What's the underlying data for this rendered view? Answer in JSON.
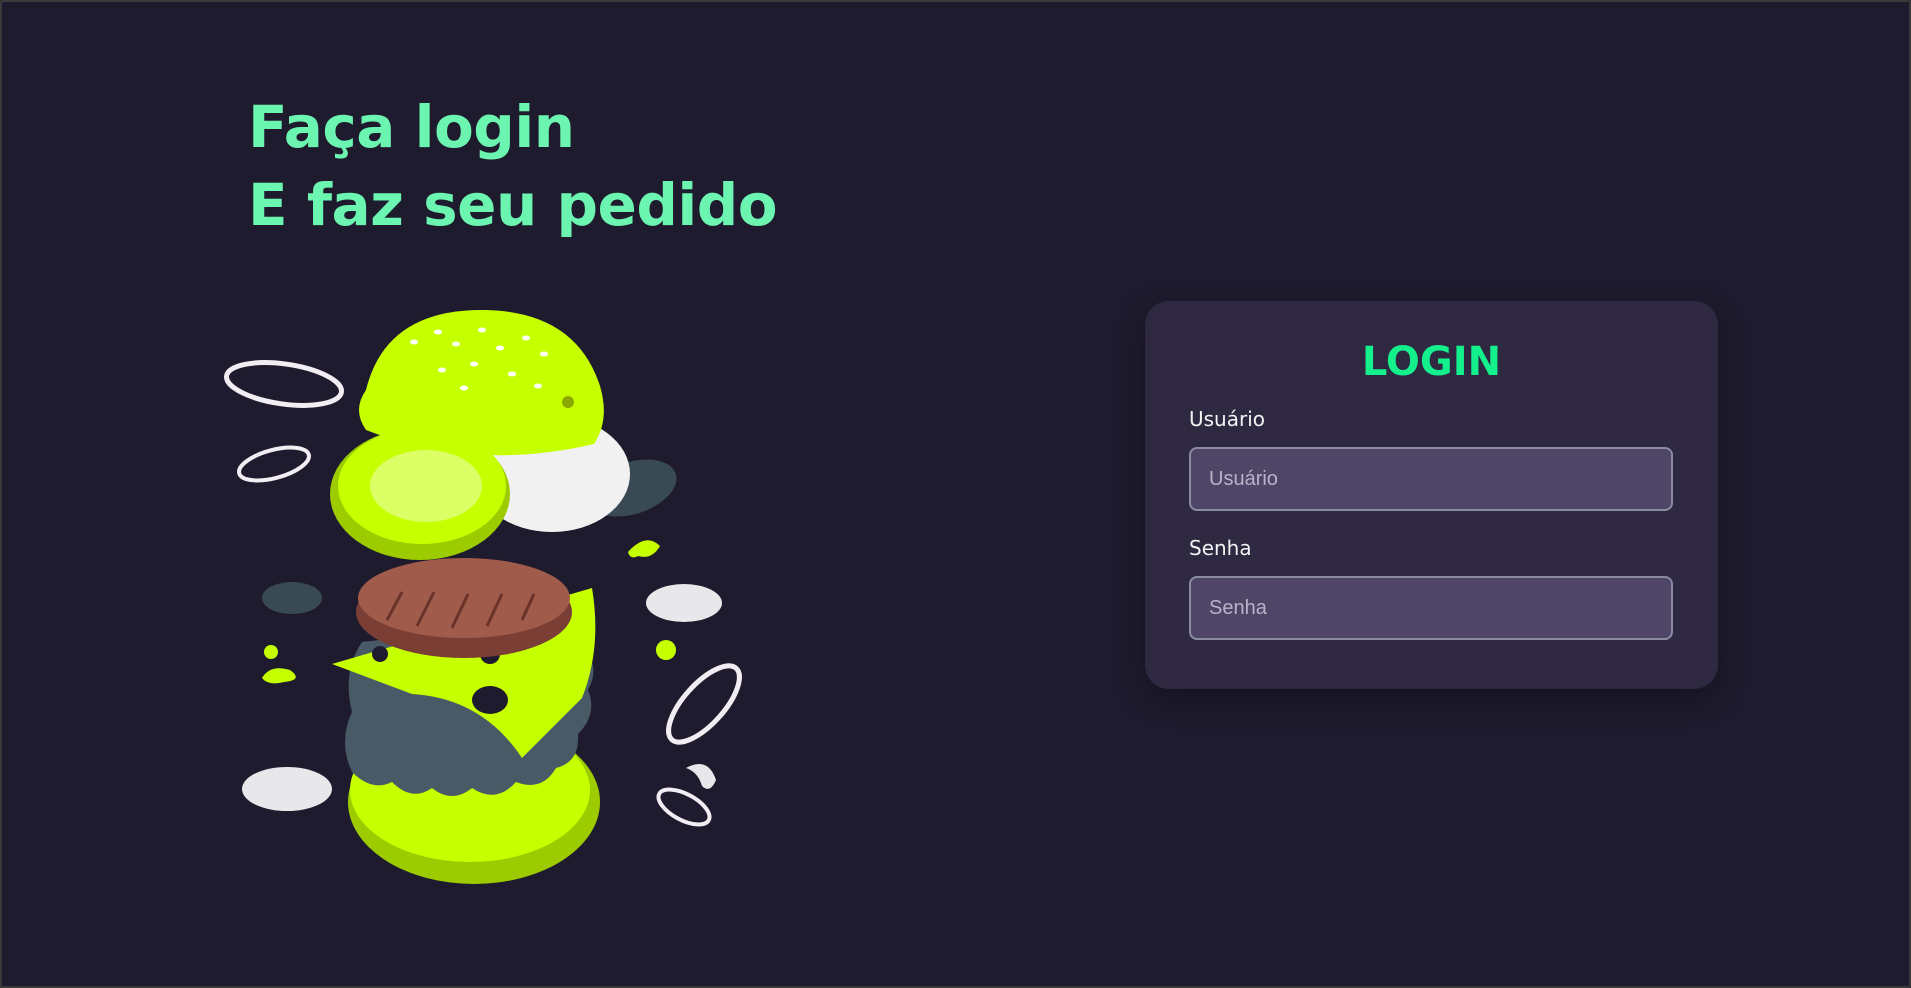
{
  "headline": {
    "line1": "Faça login",
    "line2": "E faz seu pedido"
  },
  "illustration": {
    "icon": "burger-illustration",
    "colors": {
      "bun": "#c6ff00",
      "patty": "#a15b4a",
      "lettuce": "#485a66",
      "onion": "#f1edf2"
    }
  },
  "login_card": {
    "title": "LOGIN",
    "username": {
      "label": "Usuário",
      "placeholder": "Usuário",
      "value": ""
    },
    "password": {
      "label": "Senha",
      "placeholder": "Senha",
      "value": ""
    }
  },
  "colors": {
    "background": "#1f1b2e",
    "card": "#2e2841",
    "headline": "#6cf5b0",
    "accent": "#14f08c",
    "input": "#4e4567"
  }
}
